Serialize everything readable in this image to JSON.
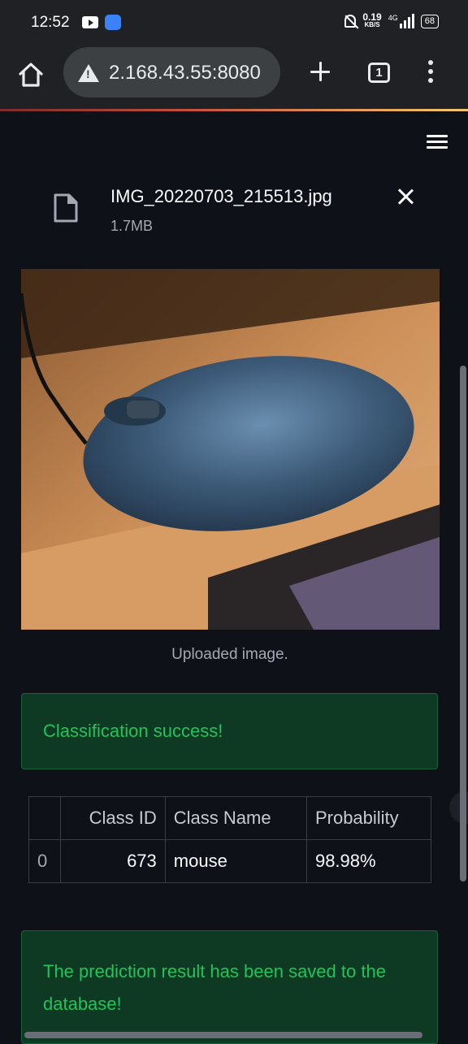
{
  "status_bar": {
    "time": "12:52",
    "net_speed": "0.19",
    "net_unit": "KB/S",
    "network": "4G",
    "battery": "68"
  },
  "browser": {
    "url": "2.168.43.55:8080",
    "tab_count": "1"
  },
  "uploader": {
    "file_name": "IMG_20220703_215513.jpg",
    "file_size": "1.7MB"
  },
  "image": {
    "caption": "Uploaded image."
  },
  "alerts": {
    "success": "Classification success!",
    "saved": "The prediction result has been saved to the database!"
  },
  "results_table": {
    "headers": [
      "",
      "Class ID",
      "Class Name",
      "Probability"
    ],
    "rows": [
      {
        "index": "0",
        "class_id": "673",
        "class_name": "mouse",
        "probability": "98.98%"
      }
    ]
  },
  "colors": {
    "background": "#0e1117",
    "success_bg": "#0e3a23",
    "success_text": "#21c35a"
  }
}
